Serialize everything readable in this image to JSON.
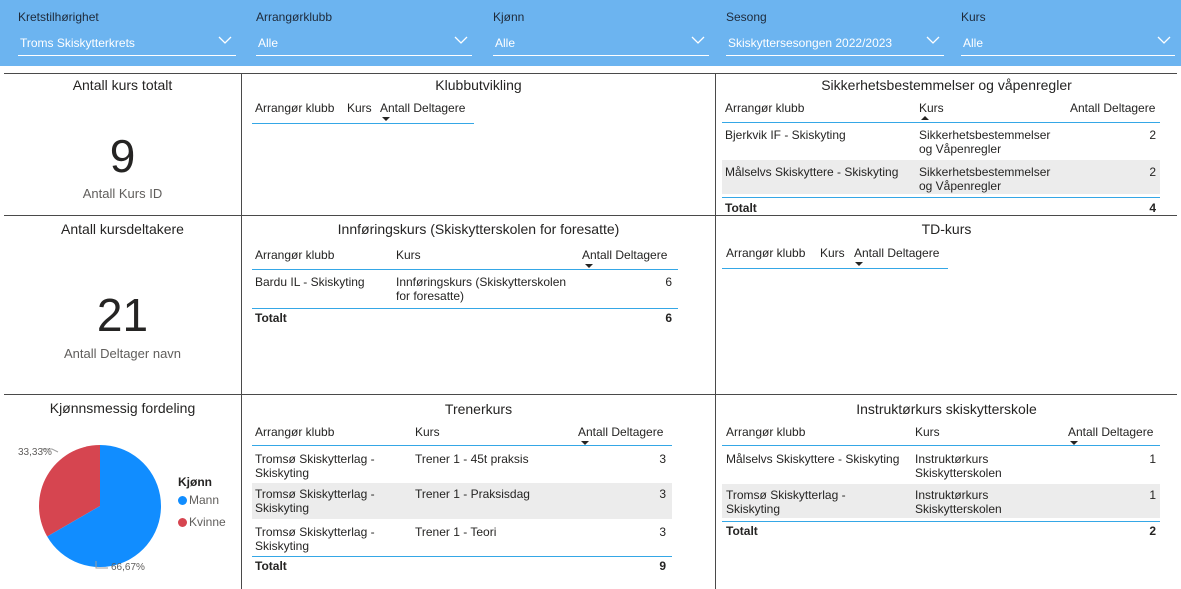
{
  "filters": [
    {
      "label": "Kretstilhørighet",
      "value": "Troms Skiskytterkrets"
    },
    {
      "label": "Arrangørklubb",
      "value": "Alle"
    },
    {
      "label": "Kjønn",
      "value": "Alle"
    },
    {
      "label": "Sesong",
      "value": "Skiskyttersesongen 2022/2023"
    },
    {
      "label": "Kurs",
      "value": "Alle"
    }
  ],
  "cards": {
    "kurs": {
      "title": "Antall kurs totalt",
      "value": "9",
      "caption": "Antall Kurs ID"
    },
    "deltakere": {
      "title": "Antall kursdeltakere",
      "value": "21",
      "caption": "Antall Deltager navn"
    }
  },
  "tables": {
    "klubbutvikling": {
      "title": "Klubbutvikling",
      "headers": [
        "Arrangør klubb",
        "Kurs",
        "Antall Deltagere"
      ]
    },
    "sikkerhet": {
      "title": "Sikkerhetsbestemmelser og våpenregler",
      "headers": [
        "Arrangør klubb",
        "Kurs",
        "Antall Deltagere"
      ],
      "rows": [
        {
          "klubb": "Bjerkvik IF - Skiskyting",
          "kurs": [
            "Sikkerhetsbestemmelser",
            "og Våpenregler"
          ],
          "antall": "2"
        },
        {
          "klubb": "Målselvs Skiskyttere - Skiskyting",
          "kurs": [
            "Sikkerhetsbestemmelser",
            "og Våpenregler"
          ],
          "antall": "2"
        }
      ],
      "total_label": "Totalt",
      "total": "4"
    },
    "innforing": {
      "title": "Innføringskurs (Skiskytterskolen for foresatte)",
      "headers": [
        "Arrangør klubb",
        "Kurs",
        "Antall Deltagere"
      ],
      "rows": [
        {
          "klubb": "Bardu IL - Skiskyting",
          "kurs": [
            "Innføringskurs (Skiskytterskolen",
            "for foresatte)"
          ],
          "antall": "6"
        }
      ],
      "total_label": "Totalt",
      "total": "6"
    },
    "td": {
      "title": "TD-kurs",
      "headers": [
        "Arrangør klubb",
        "Kurs",
        "Antall Deltagere"
      ]
    },
    "trener": {
      "title": "Trenerkurs",
      "headers": [
        "Arrangør klubb",
        "Kurs",
        "Antall Deltagere"
      ],
      "rows": [
        {
          "klubb": [
            "Tromsø Skiskytterlag -",
            "Skiskyting"
          ],
          "kurs": "Trener 1 - 45t praksis",
          "antall": "3"
        },
        {
          "klubb": [
            "Tromsø Skiskytterlag -",
            "Skiskyting"
          ],
          "kurs": "Trener 1 - Praksisdag",
          "antall": "3"
        },
        {
          "klubb": [
            "Tromsø Skiskytterlag -",
            "Skiskyting"
          ],
          "kurs": "Trener 1 - Teori",
          "antall": "3"
        }
      ],
      "total_label": "Totalt",
      "total": "9"
    },
    "instruktor": {
      "title": "Instruktørkurs skiskytterskole",
      "headers": [
        "Arrangør klubb",
        "Kurs",
        "Antall Deltagere"
      ],
      "rows": [
        {
          "klubb": [
            "Målselvs Skiskyttere - Skiskyting"
          ],
          "kurs": [
            "Instruktørkurs",
            "Skiskytterskolen"
          ],
          "antall": "1"
        },
        {
          "klubb": [
            "Tromsø Skiskytterlag -",
            "Skiskyting"
          ],
          "kurs": [
            "Instruktørkurs",
            "Skiskytterskolen"
          ],
          "antall": "1"
        }
      ],
      "total_label": "Totalt",
      "total": "2"
    }
  },
  "pie": {
    "title": "Kjønnsmessig fordeling",
    "legend_title": "Kjønn",
    "label_kvinne": "33,33%",
    "label_mann": "66,67%"
  },
  "chart_data": {
    "type": "pie",
    "title": "Kjønnsmessig fordeling",
    "legend_title": "Kjønn",
    "legend_position": "right",
    "categories": [
      "Mann",
      "Kvinne"
    ],
    "values": [
      66.67,
      33.33
    ],
    "colors": [
      "#118dff",
      "#d64550"
    ]
  },
  "colors": {
    "filter_bar": "#6cb4f0",
    "header_line": "#35a7e6",
    "banded_row": "#ececec",
    "mann": "#118dff",
    "kvinne": "#d64550"
  }
}
